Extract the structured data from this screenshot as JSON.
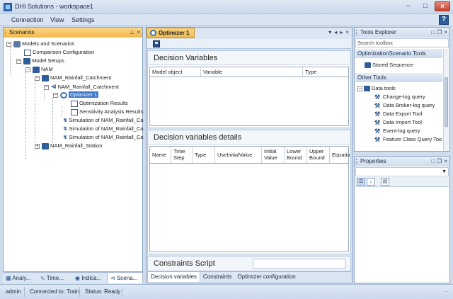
{
  "window": {
    "title": "DHI Solutions - workspace1"
  },
  "menu": {
    "items": [
      "Connection",
      "View",
      "Settings"
    ]
  },
  "scenarios_panel": {
    "title": "Scenarios",
    "tree": [
      "Models and Scenarios",
      "Comparison Configuration",
      "Model Setups",
      "NAM",
      "NAM_Rainfall_Catchment",
      "NAM_Rainfall_Catchment",
      "Optimizer 1",
      "Optimization Results",
      "Sensitivity Analysis Results",
      "Simulation of NAM_Rainfall_Ca",
      "Simulation of NAM_Rainfall_Ca",
      "Simulation of NAM_Rainfall_Ca",
      "NAM_Rainfall_Station"
    ],
    "bottom_tabs": [
      "Analy...",
      "Time...",
      "Indica...",
      "Scena..."
    ]
  },
  "document": {
    "tab_title": "Optimizer 1",
    "decision_variables": {
      "title": "Decision Variables",
      "columns": [
        "Model object",
        "Variable",
        "Type"
      ]
    },
    "decision_details": {
      "title": "Decision variables details",
      "columns": [
        "Name",
        "Time Step",
        "Type",
        "UseInitialValue",
        "Initial Value",
        "Lower Bound",
        "Upper Bound",
        "Equatio"
      ]
    },
    "constraints_script": {
      "title": "Constraints Script"
    },
    "bottom_tabs": [
      "Decision variables",
      "Constraints",
      "Optimizer configuration"
    ]
  },
  "tools_explorer": {
    "title": "Tools Explorer",
    "search_placeholder": "Search toolbox",
    "group1": "OptimizationScenario Tools",
    "group1_items": [
      "Stored Sequence"
    ],
    "group2": "Other Tools",
    "folder": "Data tools",
    "tools": [
      "Change-log query",
      "Data Broker-log query",
      "Data Export Tool",
      "Data Import Tool",
      "Event-log query",
      "Feature Class Query Too"
    ]
  },
  "properties": {
    "title": "Properties"
  },
  "status": {
    "user": "admin",
    "connection": "Connected to: Train",
    "state": "Status: Ready"
  }
}
